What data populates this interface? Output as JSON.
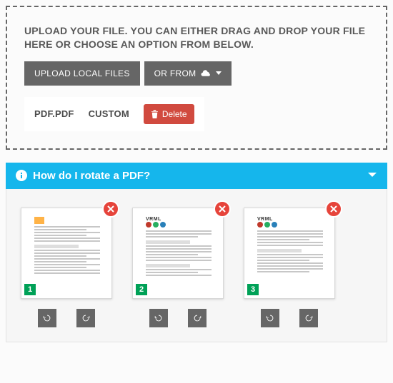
{
  "upload": {
    "instruction": "UPLOAD YOUR FILE. YOU CAN EITHER DRAG AND DROP YOUR FILE HERE OR CHOOSE AN OPTION FROM BELOW.",
    "local_btn": "UPLOAD LOCAL FILES",
    "cloud_btn": "OR FROM",
    "file_name": "PDF.PDF",
    "file_tag": "CUSTOM",
    "delete_btn": "Delete"
  },
  "accordion": {
    "title": "How do I rotate a PDF?"
  },
  "pages": [
    {
      "num": "1"
    },
    {
      "num": "2"
    },
    {
      "num": "3"
    }
  ]
}
